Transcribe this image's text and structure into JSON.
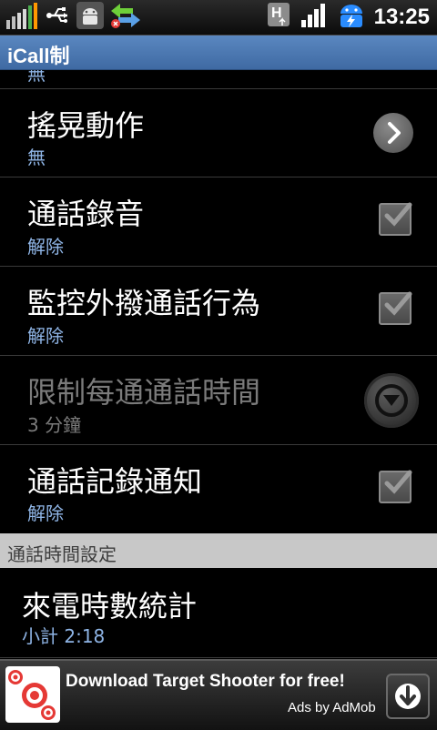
{
  "status_bar": {
    "time": "13:25",
    "icons": [
      "signal-bars-icon",
      "usb-icon",
      "android-debug-icon",
      "sync-arrows-icon",
      "h-data-icon",
      "cell-signal-icon",
      "battery-charging-icon"
    ]
  },
  "app": {
    "title": "iCall制"
  },
  "list": {
    "partial_row_subtitle": "無",
    "items": [
      {
        "title": "搖晃動作",
        "subtitle": "無",
        "control": "chevron-right"
      },
      {
        "title": "通話錄音",
        "subtitle": "解除",
        "control": "checkbox"
      },
      {
        "title": "監控外撥通話行為",
        "subtitle": "解除",
        "control": "checkbox"
      },
      {
        "title": "限制每通通話時間",
        "subtitle": "3 分鐘",
        "control": "dropdown",
        "disabled": true
      },
      {
        "title": "通話記錄通知",
        "subtitle": "解除",
        "control": "checkbox"
      }
    ]
  },
  "section": {
    "header": "通話時間設定"
  },
  "stats": {
    "title": "來電時數統計",
    "subtitle": "小計 2:18"
  },
  "ad": {
    "message": "Download Target Shooter for free!",
    "attribution": "Ads by AdMob"
  },
  "colors": {
    "title_bar": "#4a77b4",
    "subtitle": "#8fb5e6",
    "section_bg": "#c8c8c8"
  }
}
